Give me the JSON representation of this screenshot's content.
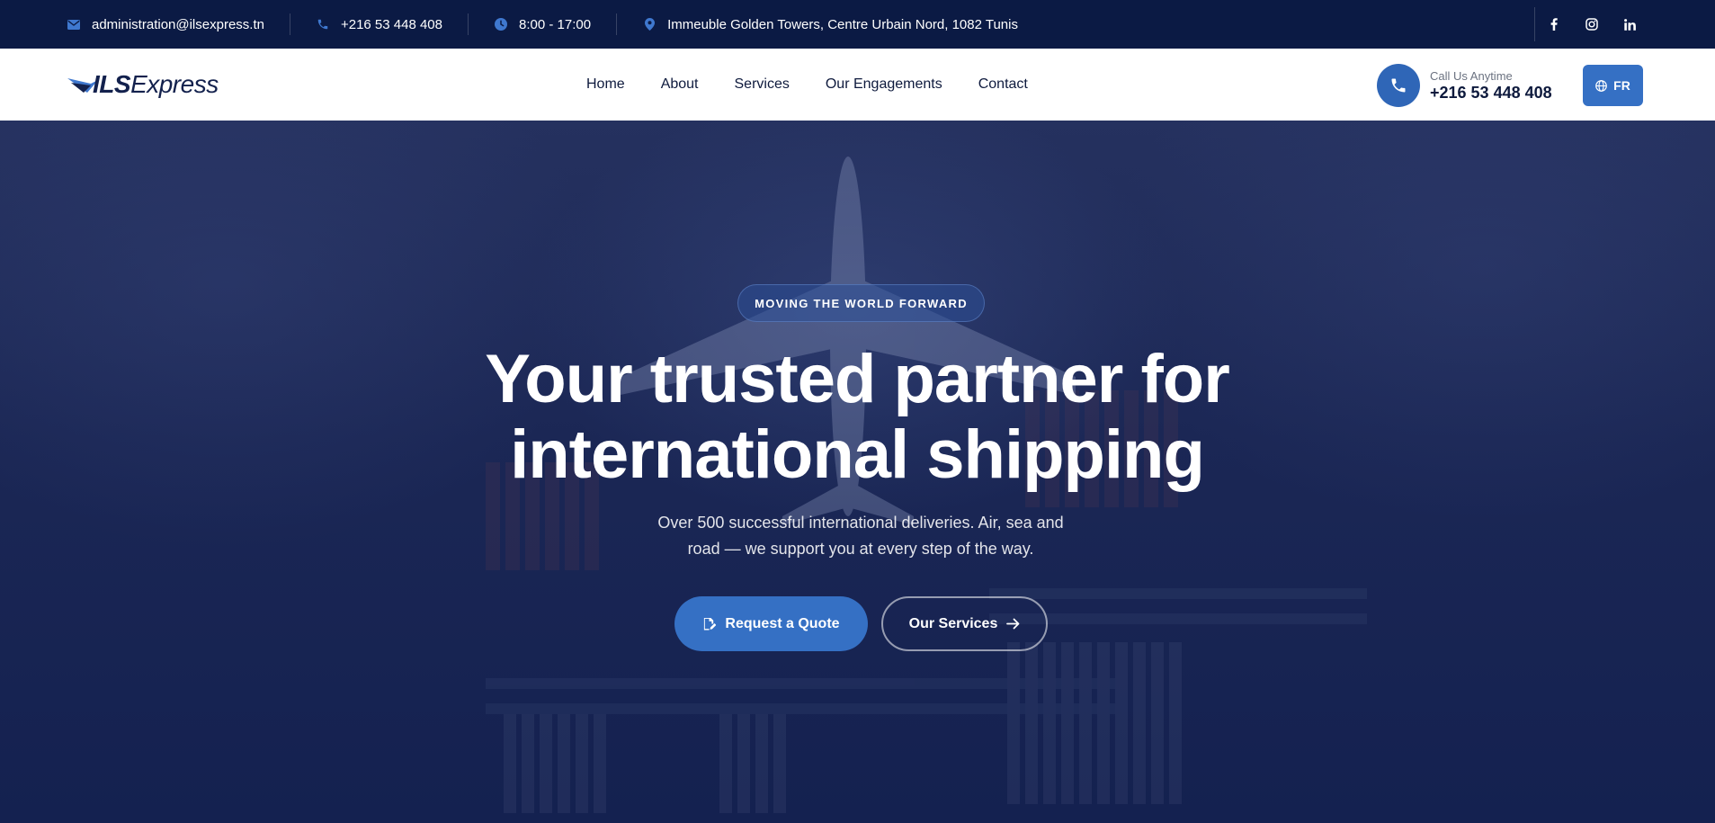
{
  "topbar": {
    "email": "administration@ilsexpress.tn",
    "phone": "+216 53 448 408",
    "hours": "8:00 - 17:00",
    "address": "Immeuble Golden Towers, Centre Urbain Nord, 1082 Tunis",
    "icons": [
      "envelope-icon",
      "phone-icon",
      "clock-icon",
      "map-pin-icon"
    ],
    "social": [
      "facebook-icon",
      "instagram-icon",
      "linkedin-icon"
    ]
  },
  "header": {
    "logo_bold": "ILS",
    "logo_light": "Express",
    "nav": [
      "Home",
      "About",
      "Services",
      "Our Engagements",
      "Contact"
    ],
    "call_label": "Call Us Anytime",
    "call_number": "+216 53 448 408",
    "lang": "FR"
  },
  "hero": {
    "badge": "MOVING THE WORLD FORWARD",
    "title_line1": "Your trusted partner for",
    "title_line2": "international shipping",
    "subtitle": "Over 500 successful international deliveries. Air, sea and road — we support you at every step of the way.",
    "primary_button": "Request a Quote",
    "secondary_button": "Our Services"
  },
  "colors": {
    "topbar_bg": "#0b1a44",
    "accent": "#3570c4",
    "nav_text": "#0e1a3d",
    "hero_overlay": "#1b2755"
  }
}
